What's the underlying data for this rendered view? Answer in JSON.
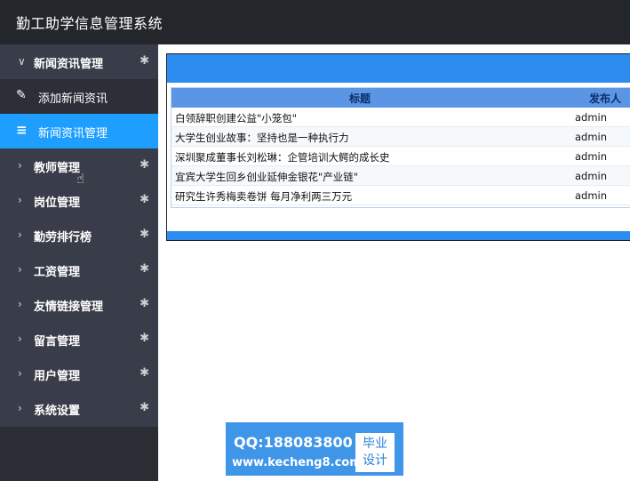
{
  "app": {
    "title": "勤工助学信息管理系统"
  },
  "sidebar": {
    "groups": [
      {
        "label": "新闻资讯管理",
        "expanded": true
      },
      {
        "label": "教师管理"
      },
      {
        "label": "岗位管理"
      },
      {
        "label": "勤劳排行榜"
      },
      {
        "label": "工资管理"
      },
      {
        "label": "友情链接管理"
      },
      {
        "label": "留言管理"
      },
      {
        "label": "用户管理"
      },
      {
        "label": "系统设置"
      }
    ],
    "sub_items": [
      {
        "label": "添加新闻资讯",
        "icon": "pencil-icon"
      },
      {
        "label": "新闻资讯管理",
        "icon": "list-icon",
        "active": true
      }
    ]
  },
  "table": {
    "headers": {
      "title": "标题",
      "publisher": "发布人"
    },
    "rows": [
      {
        "title": "白领辞职创建公益\"小笼包\"",
        "publisher": "admin"
      },
      {
        "title": "大学生创业故事：坚持也是一种执行力",
        "publisher": "admin"
      },
      {
        "title": "深圳聚成董事长刘松琳：企管培训大鳄的成长史",
        "publisher": "admin"
      },
      {
        "title": "宜宾大学生回乡创业延伸金银花\"产业链\"",
        "publisher": "admin"
      },
      {
        "title": "研究生许秀梅卖卷饼 每月净利两三万元",
        "publisher": "admin"
      }
    ]
  },
  "watermark": {
    "qq": "QQ:188083800",
    "url": "www.kecheng8.com",
    "badge_line1": "毕业",
    "badge_line2": "设计"
  },
  "colors": {
    "topbar": "#23262b",
    "sidebar": "#393d49",
    "active_item": "#1e9fff",
    "panel_header": "#2d8cf0",
    "table_header": "#5b95e6"
  }
}
